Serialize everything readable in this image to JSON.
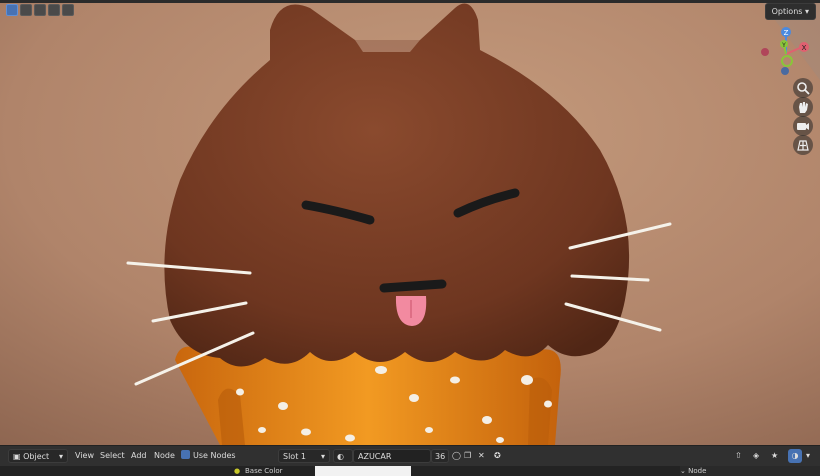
{
  "toolbar": {
    "options_label": "Options",
    "mode_label": "Object",
    "menu_view": "View",
    "menu_select": "Select",
    "menu_add": "Add",
    "menu_node": "Node",
    "use_nodes_label": "Use Nodes",
    "slot_label": "Slot 1",
    "material_name": "AZUCAR",
    "user_count": "36"
  },
  "properties": {
    "base_color_label": "Base Color",
    "node_panel_label": "Node"
  },
  "colors": {
    "accent": "#4772b3",
    "axis_x": "#e06070",
    "axis_y": "#8ac53a",
    "axis_z": "#4a8ae0"
  }
}
